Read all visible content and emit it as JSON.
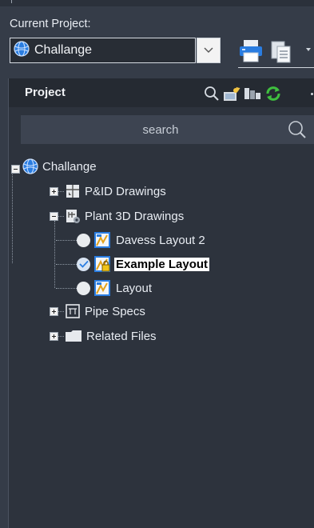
{
  "current_project": {
    "label": "Current Project:",
    "selected": "Challange"
  },
  "panel": {
    "title": "Project",
    "search_placeholder": "search"
  },
  "tree": {
    "root": "Challange",
    "pid": "P&ID Drawings",
    "plant3d": "Plant 3D Drawings",
    "drawings": [
      "Davess Layout 2",
      "Example Layout",
      "Layout"
    ],
    "pipe_specs": "Pipe Specs",
    "related": "Related Files"
  },
  "colors": {
    "background": "#353c48",
    "panel": "#2d333d",
    "header": "#252a32",
    "accent_blue": "#2a7de1",
    "refresh_green": "#3fbf3f"
  }
}
